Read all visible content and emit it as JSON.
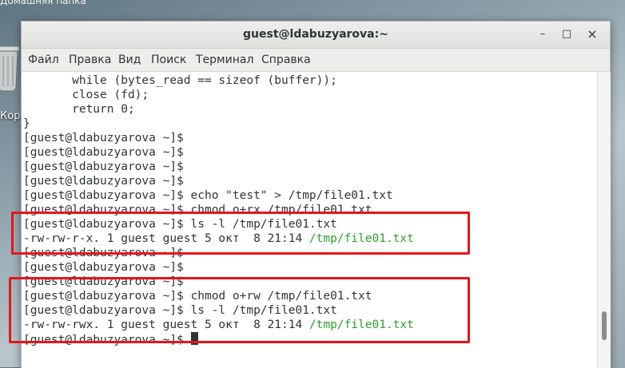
{
  "desktop": {
    "top_label": "Домашняя папка",
    "trash_label": "Корз"
  },
  "window": {
    "title": "guest@ldabuzyarova:~",
    "controls": {
      "minimize": "–",
      "maximize": "□",
      "close": "×"
    }
  },
  "menu": {
    "items": [
      "Файл",
      "Правка",
      "Вид",
      "Поиск",
      "Терминал",
      "Справка"
    ]
  },
  "terminal": {
    "lines": [
      {
        "text": "       while (bytes_read == sizeof (buffer));"
      },
      {
        "text": "       close (fd);"
      },
      {
        "text": "       return 0;"
      },
      {
        "text": "}"
      },
      {
        "text": "[guest@ldabuzyarova ~]$"
      },
      {
        "text": "[guest@ldabuzyarova ~]$"
      },
      {
        "text": "[guest@ldabuzyarova ~]$"
      },
      {
        "text": "[guest@ldabuzyarova ~]$"
      },
      {
        "text": "[guest@ldabuzyarova ~]$ echo \"test\" > /tmp/file01.txt"
      },
      {
        "text": "[guest@ldabuzyarova ~]$ chmod o+rx /tmp/file01.txt"
      },
      {
        "text": "[guest@ldabuzyarova ~]$ ls -l /tmp/file01.txt"
      },
      {
        "text": "-rw-rw-r-x. 1 guest guest 5 окт  8 21:14 ",
        "link": "/tmp/file01.txt"
      },
      {
        "text": "[guest@ldabuzyarova ~]$"
      },
      {
        "text": "[guest@ldabuzyarova ~]$"
      },
      {
        "text": "[guest@ldabuzyarova ~]$"
      },
      {
        "text": "[guest@ldabuzyarova ~]$ chmod o+rw /tmp/file01.txt"
      },
      {
        "text": "[guest@ldabuzyarova ~]$ ls -l /tmp/file01.txt"
      },
      {
        "text": "-rw-rw-rwx. 1 guest guest 5 окт  8 21:14 ",
        "link": "/tmp/file01.txt"
      },
      {
        "text": "[guest@ldabuzyarova ~]$ ",
        "cursor": true
      }
    ]
  },
  "colors": {
    "highlight": "#e8141b",
    "filename": "#2aa02a",
    "text": "#2e3436"
  }
}
